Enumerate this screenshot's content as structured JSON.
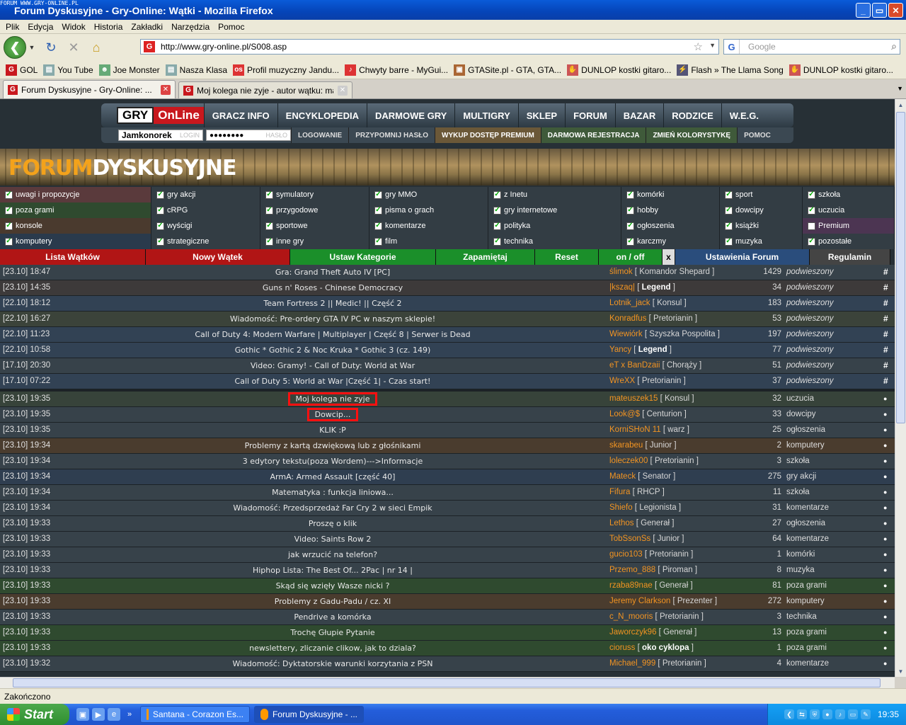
{
  "window": {
    "tiny_label": "FORUM WWW.GRY-ONLINE.PL",
    "title": "Forum Dyskusyjne - Gry-Online: Wątki - Mozilla Firefox",
    "min": "_",
    "max": "▭",
    "close": "✕"
  },
  "menu": [
    "Plik",
    "Edycja",
    "Widok",
    "Historia",
    "Zakładki",
    "Narzędzia",
    "Pomoc"
  ],
  "nav": {
    "url": "http://www.gry-online.pl/S008.asp",
    "search_placeholder": "Google",
    "favicon": "G",
    "engine": "G"
  },
  "bookmarks": [
    {
      "label": "GOL",
      "color": "#c8181e",
      "glyph": "G"
    },
    {
      "label": "You Tube",
      "color": "#8aa",
      "glyph": "▤"
    },
    {
      "label": "Joe Monster",
      "color": "#6a7",
      "glyph": "☻"
    },
    {
      "label": "Nasza Klasa",
      "color": "#8aa",
      "glyph": "▤"
    },
    {
      "label": "Profil muzyczny Jandu...",
      "color": "#d33",
      "glyph": "os"
    },
    {
      "label": "Chwyty barre - MyGui...",
      "color": "#d33",
      "glyph": "♪"
    },
    {
      "label": "GTASite.pl - GTA, GTA...",
      "color": "#a63",
      "glyph": "▣"
    },
    {
      "label": "DUNLOP kostki gitaro...",
      "color": "#c55",
      "glyph": "✋"
    },
    {
      "label": "Flash » The Llama Song",
      "color": "#557",
      "glyph": "⚡"
    },
    {
      "label": "DUNLOP kostki gitaro...",
      "color": "#c55",
      "glyph": "✋"
    }
  ],
  "tabs": [
    {
      "label": "Forum Dyskusyjne - Gry-Online: ...",
      "active": true
    },
    {
      "label": "Moj kolega nie zyje - autor wątku: mat...",
      "active": false
    }
  ],
  "site": {
    "logo_a": "GRY",
    "logo_b": "OnLine",
    "menu": [
      "GRACZ INFO",
      "ENCYKLOPEDIA",
      "DARMOWE GRY",
      "MULTIGRY",
      "SKLEP",
      "FORUM",
      "BAZAR",
      "RODZICE",
      "W.E.G."
    ],
    "login_value": "Jamkonorek",
    "login_label": "LOGIN",
    "password_value": "●●●●●●●●",
    "password_label": "HASŁO",
    "sub": [
      "LOGOWANIE",
      "PRZYPOMNIJ HASŁO",
      "WYKUP DOSTĘP PREMIUM",
      "DARMOWA REJESTRACJA",
      "ZMIEŃ KOLORYSTYKĘ",
      "POMOC"
    ],
    "banner_a": "FORUM",
    "banner_b": "DYSKUSYJNE"
  },
  "categories": [
    [
      {
        "l": "uwagi i propozycje",
        "c": "#5a3a3c",
        "on": true
      },
      {
        "l": "gry akcji",
        "c": "#333d44",
        "on": true
      },
      {
        "l": "symulatory",
        "c": "#333d44",
        "on": true
      },
      {
        "l": "gry MMO",
        "c": "#333d44",
        "on": true
      },
      {
        "l": "z Inetu",
        "c": "#333d44",
        "on": true
      },
      {
        "l": "komórki",
        "c": "#333d44",
        "on": true
      },
      {
        "l": "sport",
        "c": "#333d44",
        "on": true
      },
      {
        "l": "szkoła",
        "c": "#333d44",
        "on": true
      }
    ],
    [
      {
        "l": "poza grami",
        "c": "#2f4a2f",
        "on": true
      },
      {
        "l": "cRPG",
        "c": "#333d44",
        "on": true
      },
      {
        "l": "przygodowe",
        "c": "#333d44",
        "on": true
      },
      {
        "l": "pisma o grach",
        "c": "#333d44",
        "on": true
      },
      {
        "l": "gry internetowe",
        "c": "#333d44",
        "on": true
      },
      {
        "l": "hobby",
        "c": "#333d44",
        "on": true
      },
      {
        "l": "dowcipy",
        "c": "#333d44",
        "on": true
      },
      {
        "l": "uczucia",
        "c": "#333d44",
        "on": true
      }
    ],
    [
      {
        "l": "konsole",
        "c": "#4a3a2e",
        "on": true
      },
      {
        "l": "wyścigi",
        "c": "#333d44",
        "on": true
      },
      {
        "l": "sportowe",
        "c": "#333d44",
        "on": true
      },
      {
        "l": "komentarze",
        "c": "#333d44",
        "on": true
      },
      {
        "l": "polityka",
        "c": "#333d44",
        "on": true
      },
      {
        "l": "ogłoszenia",
        "c": "#333d44",
        "on": true
      },
      {
        "l": "książki",
        "c": "#333d44",
        "on": true
      },
      {
        "l": "Premium",
        "c": "#4c3552",
        "on": false
      }
    ],
    [
      {
        "l": "komputery",
        "c": "#2a3a4c",
        "on": true
      },
      {
        "l": "strategiczne",
        "c": "#333d44",
        "on": true
      },
      {
        "l": "inne gry",
        "c": "#333d44",
        "on": true
      },
      {
        "l": "film",
        "c": "#333d44",
        "on": true
      },
      {
        "l": "technika",
        "c": "#333d44",
        "on": true
      },
      {
        "l": "karczmy",
        "c": "#333d44",
        "on": true
      },
      {
        "l": "muzyka",
        "c": "#333d44",
        "on": true
      },
      {
        "l": "pozostałe",
        "c": "#333d44",
        "on": true
      }
    ]
  ],
  "toolbar": [
    "Lista Wątków",
    "Nowy Wątek",
    "Ustaw Kategorie",
    "Zapamiętaj",
    "Reset",
    "on / off",
    "x",
    "Ustawienia Forum",
    "Regulamin"
  ],
  "pinned": [
    {
      "d": "[23.10] 18:47",
      "t": "Gra: Grand Theft Auto IV [PC]",
      "n": "ślimok",
      "r": "Komandor Shepard",
      "b": false,
      "c": "1429",
      "cat": "podwieszony",
      "bg": "#37424a"
    },
    {
      "d": "[23.10] 14:35",
      "t": "Guns n' Roses - Chinese Democracy",
      "n": "|kszaq|",
      "r": "Legend",
      "b": true,
      "c": "34",
      "cat": "podwieszony",
      "bg": "#3d3a3a"
    },
    {
      "d": "[22.10] 18:12",
      "t": "Team Fortress 2 || Medic! || Część 2",
      "n": "Lotnik_jack",
      "r": "Konsul",
      "b": false,
      "c": "183",
      "cat": "podwieszony",
      "bg": "#324254"
    },
    {
      "d": "[22.10] 16:27",
      "t": "Wiadomość: Pre-ordery GTA IV PC w naszym sklepie!",
      "n": "Konradfus",
      "r": "Pretorianin",
      "b": false,
      "c": "53",
      "cat": "podwieszony",
      "bg": "#3b433a"
    },
    {
      "d": "[22.10] 11:23",
      "t": "Call of Duty 4: Modern Warfare | Multiplayer | Część 8 | Serwer is Dead",
      "n": "Wiewiórk",
      "r": "Szyszka Pospolita",
      "b": false,
      "c": "197",
      "cat": "podwieszony",
      "bg": "#324254"
    },
    {
      "d": "[22.10] 10:58",
      "t": "Gothic * Gothic 2 & Noc Kruka * Gothic 3 (cz. 149)",
      "n": "Yancy",
      "r": "Legend",
      "b": true,
      "c": "77",
      "cat": "podwieszony",
      "bg": "#324254"
    },
    {
      "d": "[17.10] 20:30",
      "t": "Video: Gramy! - Call of Duty: World at War",
      "n": "eT x BanDzaii",
      "r": "Chorąży",
      "b": false,
      "c": "51",
      "cat": "podwieszony",
      "bg": "#37424a"
    },
    {
      "d": "[17.10] 07:22",
      "t": "Call of Duty 5: World at War |Część 1| - Czas start!",
      "n": "WreXX",
      "r": "Pretorianin",
      "b": false,
      "c": "37",
      "cat": "podwieszony",
      "bg": "#324254"
    }
  ],
  "threads": [
    {
      "d": "[23.10] 19:35",
      "t": "Moj kolega nie zyje",
      "n": "mateuszek15",
      "r": "Konsul",
      "b": false,
      "c": "32",
      "cat": "uczucia",
      "bg": "#37433a",
      "hl": true
    },
    {
      "d": "[23.10] 19:35",
      "t": "Dowcip...",
      "n": "Look@$",
      "r": "Centurion",
      "b": false,
      "c": "33",
      "cat": "dowcipy",
      "bg": "#37424a",
      "hl": true
    },
    {
      "d": "[23.10] 19:35",
      "t": "KLIK :P",
      "n": "KorniSHoN 11",
      "r": "warz",
      "b": false,
      "c": "25",
      "cat": "ogłoszenia",
      "bg": "#37424a",
      "hl": false
    },
    {
      "d": "[23.10] 19:34",
      "t": "Problemy z kartą dzwiękową lub z głośnikami",
      "n": "skarabeu",
      "r": "Junior",
      "b": false,
      "c": "2",
      "cat": "komputery",
      "bg": "#4a3c2e",
      "hl": false
    },
    {
      "d": "[23.10] 19:34",
      "t": "3 edytory tekstu(poza Wordem)--->Informacje",
      "n": "loleczek00",
      "r": "Pretorianin",
      "b": false,
      "c": "3",
      "cat": "szkoła",
      "bg": "#37424a",
      "hl": false
    },
    {
      "d": "[23.10] 19:34",
      "t": "ArmA: Armed Assault [część 40]",
      "n": "Mateck",
      "r": "Senator",
      "b": false,
      "c": "275",
      "cat": "gry akcji",
      "bg": "#2f3e50",
      "hl": false
    },
    {
      "d": "[23.10] 19:34",
      "t": "Matematyka : funkcja liniowa...",
      "n": "Fifura",
      "r": "RHCP",
      "b": false,
      "c": "11",
      "cat": "szkoła",
      "bg": "#37424a",
      "hl": false
    },
    {
      "d": "[23.10] 19:34",
      "t": "Wiadomość: Przedsprzedaż Far Cry 2 w sieci Empik",
      "n": "Shiefo",
      "r": "Legionista",
      "b": false,
      "c": "31",
      "cat": "komentarze",
      "bg": "#37424a",
      "hl": false
    },
    {
      "d": "[23.10] 19:33",
      "t": "Proszę o klik",
      "n": "Lethos",
      "r": "Generał",
      "b": false,
      "c": "27",
      "cat": "ogłoszenia",
      "bg": "#37424a",
      "hl": false
    },
    {
      "d": "[23.10] 19:33",
      "t": "Video: Saints Row 2",
      "n": "TobSsonSs",
      "r": "Junior",
      "b": false,
      "c": "64",
      "cat": "komentarze",
      "bg": "#37424a",
      "hl": false
    },
    {
      "d": "[23.10] 19:33",
      "t": "jak wrzucić na telefon?",
      "n": "gucio103",
      "r": "Pretorianin",
      "b": false,
      "c": "1",
      "cat": "komórki",
      "bg": "#37424a",
      "hl": false
    },
    {
      "d": "[23.10] 19:33",
      "t": "Hiphop Lista: The Best Of... 2Pac | nr 14 |",
      "n": "Przemo_888",
      "r": "Piroman",
      "b": false,
      "c": "8",
      "cat": "muzyka",
      "bg": "#37424a",
      "hl": false
    },
    {
      "d": "[23.10] 19:33",
      "t": "Skąd się wzięły Wasze nicki ?",
      "n": "rzaba89nae",
      "r": "Generał",
      "b": false,
      "c": "81",
      "cat": "poza grami",
      "bg": "#2f4a2f",
      "hl": false
    },
    {
      "d": "[23.10] 19:33",
      "t": "Problemy z Gadu-Padu / cz. XI",
      "n": "Jeremy Clarkson",
      "r": "Prezenter",
      "b": false,
      "c": "272",
      "cat": "komputery",
      "bg": "#4a3c2e",
      "hl": false
    },
    {
      "d": "[23.10] 19:33",
      "t": "Pendrive a komórka",
      "n": "c_N_mooris",
      "r": "Pretorianin",
      "b": false,
      "c": "3",
      "cat": "technika",
      "bg": "#37424a",
      "hl": false
    },
    {
      "d": "[23.10] 19:33",
      "t": "Trochę Głupie Pytanie",
      "n": "Jaworczyk96",
      "r": "Generał",
      "b": false,
      "c": "13",
      "cat": "poza grami",
      "bg": "#2f4a2f",
      "hl": false
    },
    {
      "d": "[23.10] 19:33",
      "t": "newslettery, zliczanie clikow, jak to dziala?",
      "n": "cioruss",
      "r": "oko cyklopa",
      "b": true,
      "c": "1",
      "cat": "poza grami",
      "bg": "#2f4a2f",
      "hl": false
    },
    {
      "d": "[23.10] 19:32",
      "t": "Wiadomość: Dyktatorskie warunki korzytania z PSN",
      "n": "Michael_999",
      "r": "Pretorianin",
      "b": false,
      "c": "4",
      "cat": "komentarze",
      "bg": "#37424a",
      "hl": false
    }
  ],
  "status": "Zakończono",
  "taskbar": {
    "start": "Start",
    "tasks": [
      "Santana - Corazon Es...",
      "Forum Dyskusyjne - ..."
    ],
    "clock": "19:35"
  }
}
